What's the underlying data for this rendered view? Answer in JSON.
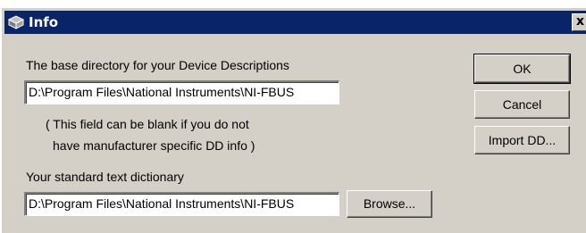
{
  "window": {
    "title": "Info",
    "title_icon": "app-book-icon",
    "close_glyph": "x"
  },
  "dd_directory": {
    "label": "The base directory for your Device Descriptions",
    "value": "D:\\Program Files\\National Instruments\\NI-FBUS",
    "note_line1": "( This field can be blank if you do not",
    "note_line2": "have manufacturer specific DD info )"
  },
  "text_dictionary": {
    "label": "Your standard text dictionary",
    "value": "D:\\Program Files\\National Instruments\\NI-FBUS",
    "browse_label": "Browse..."
  },
  "buttons": {
    "ok": "OK",
    "cancel": "Cancel",
    "import_dd": "Import DD..."
  },
  "colors": {
    "titlebar": "#0a246a",
    "face": "#d4d0c8"
  }
}
